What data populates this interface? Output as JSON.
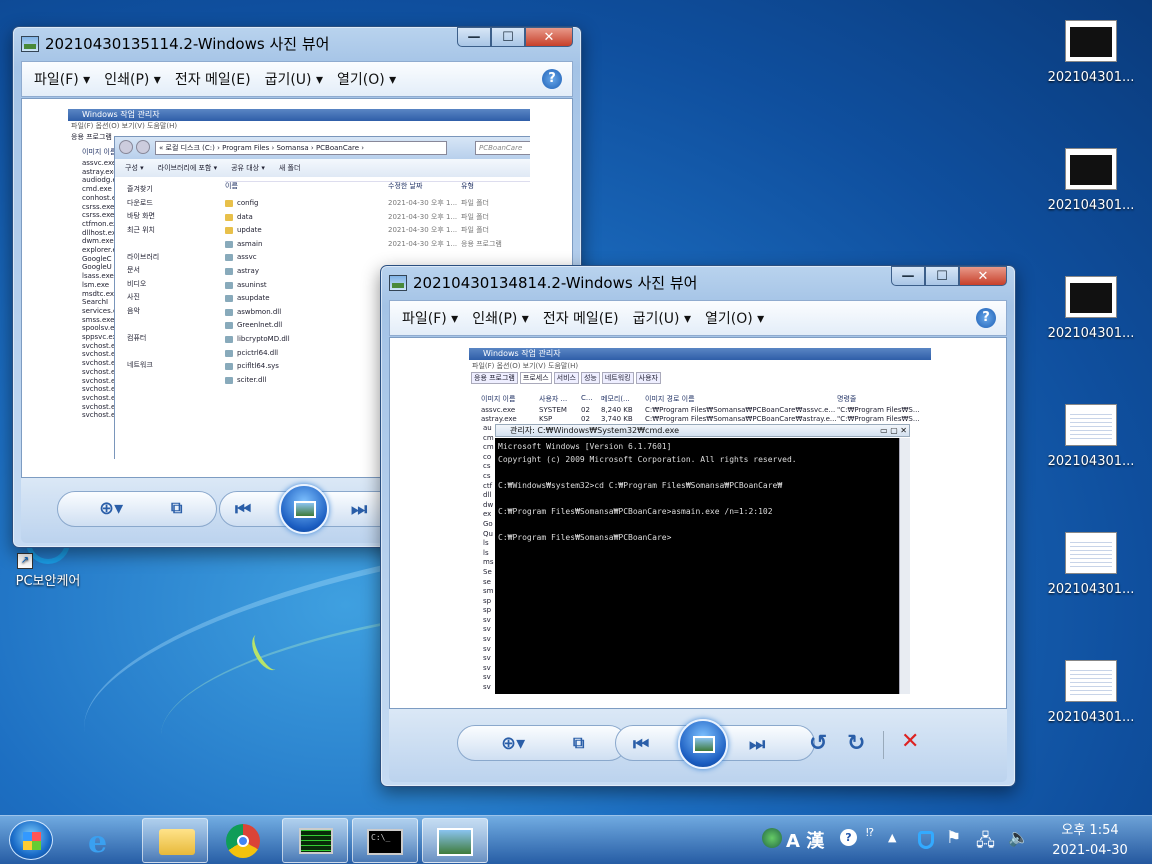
{
  "desktop": {
    "icons": [
      {
        "label": "202104301...",
        "kind": "cmd"
      },
      {
        "label": "202104301...",
        "kind": "cmd"
      },
      {
        "label": "202104301...",
        "kind": "cmd"
      },
      {
        "label": "202104301...",
        "kind": "table"
      },
      {
        "label": "202104301...",
        "kind": "table"
      },
      {
        "label": "202104301...",
        "kind": "table"
      }
    ],
    "pc_icon_label": "PC보안케어"
  },
  "window_back": {
    "title": "20210430135114.2-Windows 사진 뷰어",
    "menu": [
      "파일(F) ▾",
      "인쇄(P) ▾",
      "전자 메일(E)",
      "굽기(U) ▾",
      "열기(O) ▾"
    ],
    "help": "?",
    "shot": {
      "taskmgr_title": "Windows 작업 관리자",
      "taskmgr_menu": "파일(F)  옵션(O)  보기(V)  도움말(H)",
      "tab": "응용 프로그램",
      "col_header": "이미지 이름",
      "processes": [
        "assvc.exe",
        "astray.exe",
        "audiodg.exe",
        "cmd.exe",
        "conhost.exe",
        "csrss.exe",
        "csrss.exe",
        "ctfmon.exe",
        "dllhost.exe",
        "dwm.exe",
        "explorer.exe",
        "GoogleC",
        "GoogleU",
        "lsass.exe",
        "lsm.exe",
        "msdtc.exe",
        "SearchI",
        "services.exe",
        "smss.exe",
        "spoolsv.exe",
        "sppsvc.exe",
        "svchost.exe",
        "svchost.exe",
        "svchost.exe",
        "svchost.exe",
        "svchost.exe",
        "svchost.exe",
        "svchost.exe",
        "svchost.exe",
        "svchost.exe"
      ],
      "explorer_path": "« 로컬 디스크 (C:) › Program Files › Somansa › PCBoanCare ›",
      "explorer_search": "PCBoanCare",
      "toolbar": [
        "구성 ▾",
        "라이브러리에 포함 ▾",
        "공유 대상 ▾",
        "새 폴더"
      ],
      "nav": [
        "즐겨찾기",
        "다운로드",
        "바탕 화면",
        "최근 위치",
        "",
        "라이브러리",
        "문서",
        "비디오",
        "사진",
        "음악",
        "",
        "컴퓨터",
        "",
        "네트워크"
      ],
      "cols": [
        "이름",
        "수정한 날짜",
        "유형"
      ],
      "files": [
        {
          "name": "config",
          "date": "2021-04-30 오후 1...",
          "type": "파일 폴더"
        },
        {
          "name": "data",
          "date": "2021-04-30 오후 1...",
          "type": "파일 폴더"
        },
        {
          "name": "update",
          "date": "2021-04-30 오후 1...",
          "type": "파일 폴더"
        },
        {
          "name": "asmain",
          "date": "2021-04-30 오후 1...",
          "type": "응용 프로그램"
        },
        {
          "name": "assvc",
          "date": "",
          "type": ""
        },
        {
          "name": "astray",
          "date": "",
          "type": ""
        },
        {
          "name": "asuninst",
          "date": "",
          "type": ""
        },
        {
          "name": "asupdate",
          "date": "",
          "type": ""
        },
        {
          "name": "aswbmon.dll",
          "date": "",
          "type": ""
        },
        {
          "name": "Greenlnet.dll",
          "date": "",
          "type": ""
        },
        {
          "name": "libcryptoMD.dll",
          "date": "",
          "type": ""
        },
        {
          "name": "pcictrl64.dll",
          "date": "",
          "type": ""
        },
        {
          "name": "pcifltl64.sys",
          "date": "",
          "type": ""
        },
        {
          "name": "sciter.dll",
          "date": "",
          "type": ""
        }
      ]
    }
  },
  "window_front": {
    "title": "20210430134814.2-Windows 사진 뷰어",
    "menu": [
      "파일(F) ▾",
      "인쇄(P) ▾",
      "전자 메일(E)",
      "굽기(U) ▾",
      "열기(O) ▾"
    ],
    "help": "?",
    "shot": {
      "taskmgr_title": "Windows 작업 관리자",
      "taskmgr_menu": "파일(F)  옵션(O)  보기(V)  도움말(H)",
      "tabs": [
        "응용 프로그램",
        "프로세스",
        "서비스",
        "성능",
        "네트워킹",
        "사용자"
      ],
      "headers": [
        "이미지 이름",
        "사용자 ...",
        "C...",
        "메모리(...",
        "이미지 경로 이름",
        "명령줄"
      ],
      "rows": [
        [
          "assvc.exe",
          "SYSTEM",
          "02",
          "8,240 KB",
          "C:₩Program Files₩Somansa₩PCBoanCare₩assvc.e...",
          "\"C:₩Program Files₩S..."
        ],
        [
          "astray.exe",
          "KSP",
          "02",
          "3,740 KB",
          "C:₩Program Files₩Somansa₩PCBoanCare₩astray.e...",
          "\"C:₩Program Files₩S..."
        ]
      ],
      "left_list": [
        "au",
        "cm",
        "cm",
        "co",
        "cs",
        "cs",
        "ctf",
        "dll",
        "dw",
        "ex",
        "Go",
        "Qu",
        "ls",
        "ls",
        "ms",
        "Se",
        "se",
        "sm",
        "sp",
        "sp",
        "sv",
        "sv",
        "sv",
        "sv",
        "sv",
        "sv",
        "sv",
        "sv"
      ],
      "cmd_title": "관리자: C:₩Windows₩System32₩cmd.exe",
      "cmd_lines": [
        "Microsoft Windows [Version 6.1.7601]",
        "Copyright (c) 2009 Microsoft Corporation. All rights reserved.",
        "",
        "C:₩Windows₩system32>cd C:₩Program Files₩Somansa₩PCBoanCare₩",
        "",
        "C:₩Program Files₩Somansa₩PCBoanCare>asmain.exe /n=1:2:102",
        "",
        "C:₩Program Files₩Somansa₩PCBoanCare>"
      ]
    }
  },
  "taskbar": {
    "ime": "A 漢",
    "time": "오후 1:54",
    "date": "2021-04-30"
  }
}
